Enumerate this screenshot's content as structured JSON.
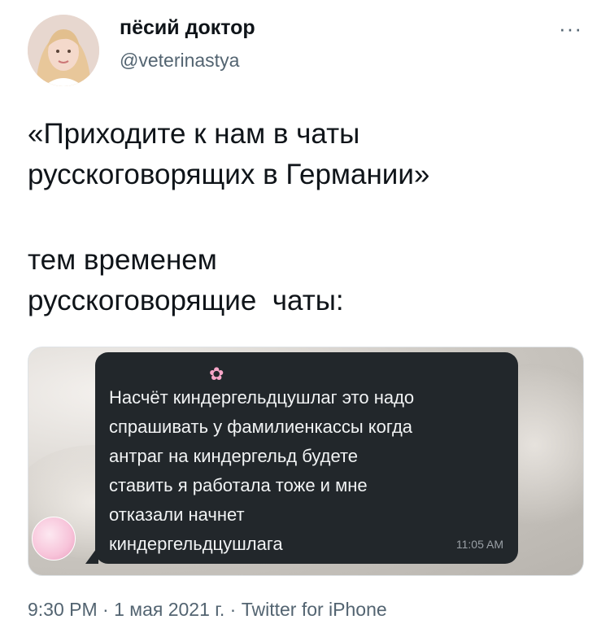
{
  "author": {
    "display_name": "пёсий доктор",
    "handle": "@veterinastya"
  },
  "tweet": {
    "paragraph1_line1": "«Приходите к нам в чаты",
    "paragraph1_line2": "русскоговорящих в Германии»",
    "paragraph2_line1": "тем временем",
    "paragraph2_line2": "русскоговорящие  чаты:"
  },
  "media": {
    "message_lines": [
      "Насчёт киндергельдцушлаг это надо",
      "спрашивать у фамилиенкассы когда",
      "антраг на киндергельд будете",
      "ставить я работала тоже и мне",
      "отказали начнет",
      "киндергельдцушлага"
    ],
    "message_time": "11:05 AM",
    "icon": "flower-icon"
  },
  "meta": {
    "timestamp": "9:30 PM · 1 мая 2021 г. · Twitter for iPhone"
  },
  "colors": {
    "text": "#0f1419",
    "secondary": "#536471",
    "bubble": "#22272b"
  }
}
